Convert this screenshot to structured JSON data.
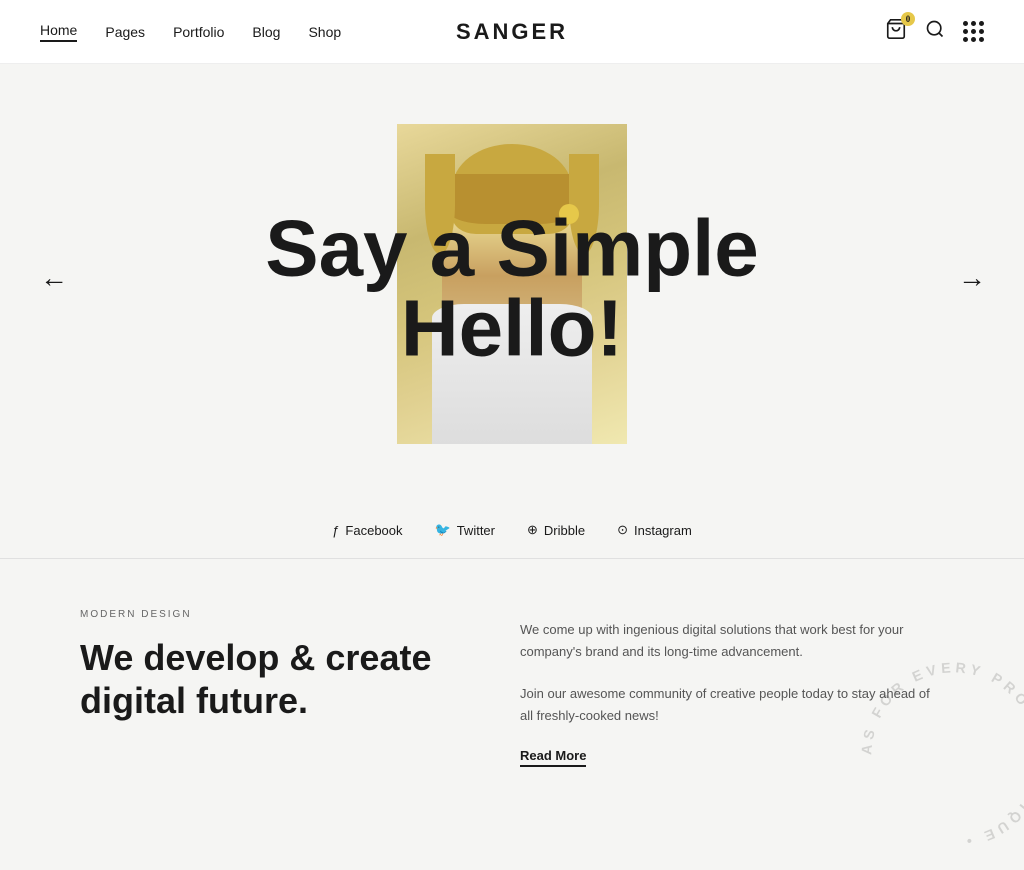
{
  "nav": {
    "logo": "SANGER",
    "links": [
      {
        "label": "Home",
        "active": true
      },
      {
        "label": "Pages",
        "active": false
      },
      {
        "label": "Portfolio",
        "active": false
      },
      {
        "label": "Blog",
        "active": false
      },
      {
        "label": "Shop",
        "active": false
      }
    ],
    "cart_icon": "🛒",
    "search_icon": "🔍",
    "cart_count": "0"
  },
  "hero": {
    "heading_line1": "Say a Simple",
    "heading_line2": "Hello!",
    "arrow_left": "←",
    "arrow_right": "→"
  },
  "social": {
    "items": [
      {
        "icon": "f",
        "label": "Facebook"
      },
      {
        "icon": "𝕏",
        "label": "Twitter"
      },
      {
        "icon": "◎",
        "label": "Dribble"
      },
      {
        "icon": "⊙",
        "label": "Instagram"
      }
    ]
  },
  "lower": {
    "section_label": "MODERN DESIGN",
    "heading": "We develop & create digital future.",
    "body1": "We come up with ingenious digital solutions that work best for your company's brand and its long-time advancement.",
    "body2": "Join our awesome community of creative people today to stay ahead of all freshly-cooked news!",
    "read_more": "Read More"
  },
  "watermark": {
    "text": "AS FOR EVERY PROJECT. UNIQUE"
  }
}
